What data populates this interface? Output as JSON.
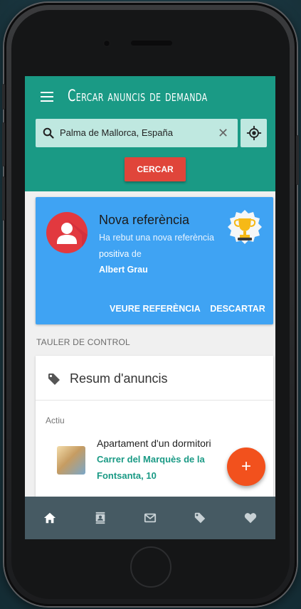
{
  "app": {
    "title": "Cercar anuncis de demanda"
  },
  "search": {
    "value": "Palma de Mallorca, España",
    "clear_glyph": "✕",
    "button_label": "CERCAR"
  },
  "referral_card": {
    "title": "Nova referència",
    "text_before": "Ha rebut una nova referència ",
    "highlight": "positiva",
    "text_after": " de",
    "name": "Albert Grau",
    "action_view": "VEURE REFERÈNCIA",
    "action_dismiss": "DESCARTAR",
    "color": "#3fa3f3"
  },
  "dashboard": {
    "section_label": "TAULER DE CONTROL",
    "card_title": "Resum d'anuncis",
    "status_label": "Actiu",
    "listing": {
      "title": "Apartament d'un dormitori",
      "address": "Carrer del Marquès de la Fontsanta, 10"
    }
  },
  "fab": {
    "label": "+"
  },
  "bottom_nav": {
    "items": [
      {
        "icon": "home-icon",
        "active": true
      },
      {
        "icon": "contacts-icon",
        "active": false
      },
      {
        "icon": "mail-icon",
        "active": false
      },
      {
        "icon": "tag-icon",
        "active": false
      },
      {
        "icon": "heart-icon",
        "active": false
      }
    ]
  },
  "colors": {
    "primary": "#1a9a85",
    "accent": "#e0453a",
    "fab": "#f2511d",
    "bottom_nav": "#465a63"
  }
}
